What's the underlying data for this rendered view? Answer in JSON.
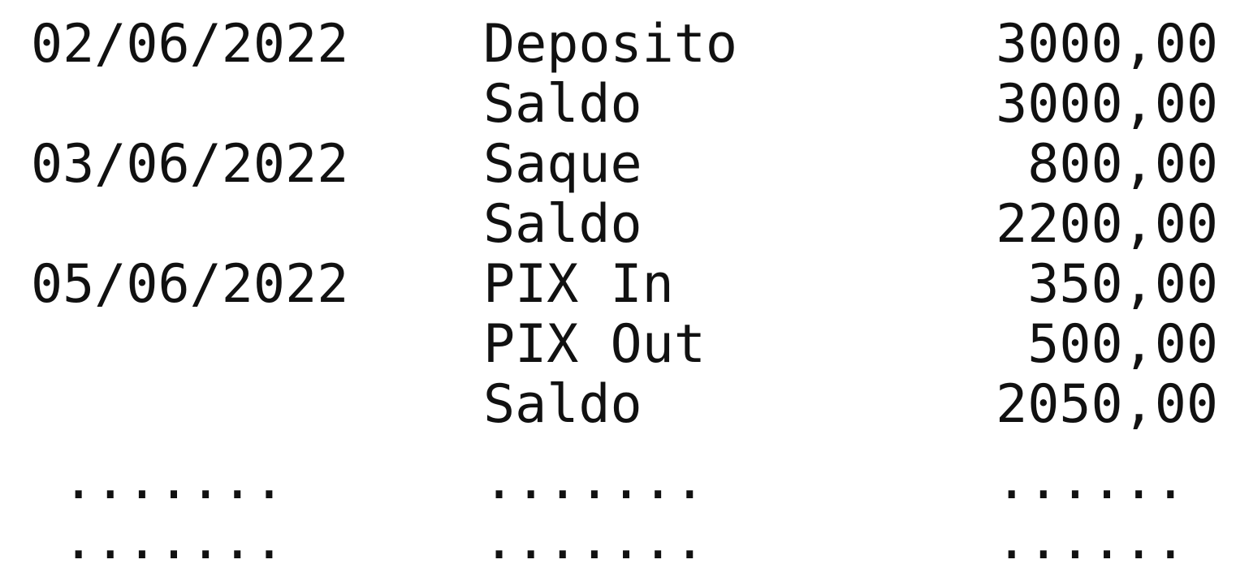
{
  "rows": [
    {
      "date": "02/06/2022",
      "description": "Deposito",
      "amount": "3000,00"
    },
    {
      "date": "",
      "description": "Saldo",
      "amount": "3000,00"
    },
    {
      "date": "03/06/2022",
      "description": "Saque",
      "amount": "800,00"
    },
    {
      "date": "",
      "description": "Saldo",
      "amount": "2200,00"
    },
    {
      "date": "05/06/2022",
      "description": "PIX In",
      "amount": "350,00"
    },
    {
      "date": "",
      "description": "PIX Out",
      "amount": "500,00"
    },
    {
      "date": "",
      "description": "Saldo",
      "amount": "2050,00"
    }
  ],
  "ellipsis_rows": [
    {
      "date": " .......",
      "description": ".......",
      "amount": "...... "
    },
    {
      "date": " .......",
      "description": ".......",
      "amount": "...... "
    }
  ]
}
